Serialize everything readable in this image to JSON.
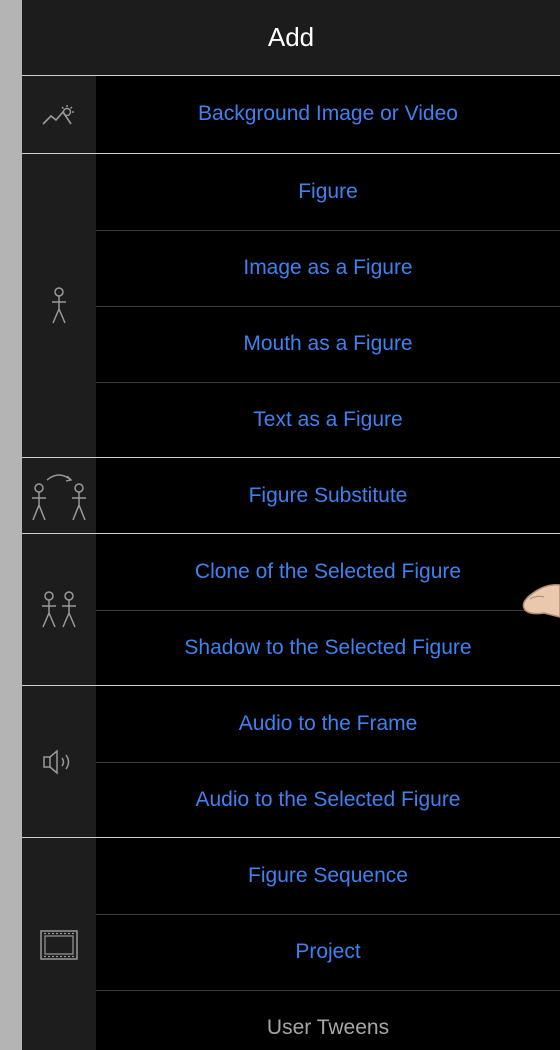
{
  "header": {
    "title": "Add"
  },
  "groups": [
    {
      "icon": "background-icon",
      "rows": [
        "Background Image or Video"
      ]
    },
    {
      "icon": "figure-icon",
      "rows": [
        "Figure",
        "Image as a Figure",
        "Mouth as a Figure",
        "Text as a Figure"
      ]
    },
    {
      "icon": "figure-substitute-icon",
      "rows": [
        "Figure Substitute"
      ]
    },
    {
      "icon": "clone-figures-icon",
      "rows": [
        "Clone of the Selected Figure",
        "Shadow to the Selected Figure"
      ]
    },
    {
      "icon": "speaker-icon",
      "rows": [
        "Audio to the Frame",
        "Audio to the Selected Figure"
      ]
    },
    {
      "icon": "film-icon",
      "rows": [
        "Figure Sequence",
        "Project",
        "User Tweens"
      ]
    }
  ],
  "colors": {
    "accent": "#3d82f0",
    "disabled": "#a6a6a6",
    "header_bg": "#1c1c1c",
    "icon_col_bg": "#1d1d1d"
  }
}
